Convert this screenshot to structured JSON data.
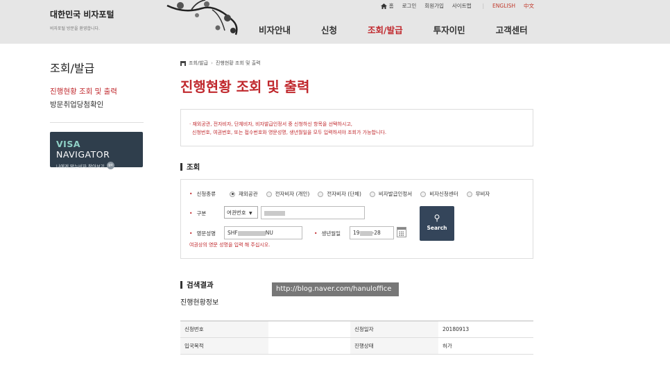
{
  "header": {
    "brand_title": "대한민국 비자포털",
    "brand_subtitle": "비자포털 방문을 환영합니다.",
    "utility": {
      "home": "홈",
      "login": "로그인",
      "join": "회원가입",
      "sitemap": "사이트맵",
      "english": "ENGLISH",
      "chinese": "中文"
    },
    "nav": [
      "비자안내",
      "신청",
      "조회/발급",
      "투자이민",
      "고객센터"
    ],
    "accent_color": "#c0282d"
  },
  "sidebar": {
    "title": "조회/발급",
    "items": [
      "진행현황 조회 및 출력",
      "방문취업당첨확인"
    ],
    "banner": {
      "title_bold": "VISA",
      "title_rest": " NAVIGATOR",
      "subtitle": "나에게 맞는비자 찾아보기",
      "go": "go"
    }
  },
  "main": {
    "breadcrumb": [
      "조회/발급",
      "진행현황 조회 및 출력"
    ],
    "title": "진행현황 조회 및 출력",
    "notice_line1": "· 재외공관, 전자비자, 단체비자, 비자발급인정서 중 신청하신 항목을 선택하시고,",
    "notice_line2": "신청번호, 여권번호, 또는 접수번호와 영문성명, 생년월일을 모두 입력하셔야 조회가 가능합니다.",
    "search_section": "조회",
    "form": {
      "type_label": "신청종류",
      "type_options": [
        "재외공관",
        "전자비자 (개인)",
        "전자비자 (단체)",
        "비자발급인정서",
        "비자신청센터",
        "무비자"
      ],
      "type_selected": "재외공관",
      "category_label": "구분",
      "category_select": "여권번호",
      "category_value": "",
      "name_label": "영문성명",
      "name_prefix": "SHF",
      "name_suffix": "NU",
      "birth_label": "생년월일",
      "birth_prefix": "19",
      "birth_suffix": "-28",
      "hint": "여권상의 영문 성명을 입력 해 주십시오.",
      "search_button": "Search"
    },
    "watermark": "http://blog.naver.com/hanuloffice",
    "result_section": "검색결과",
    "result_subtitle": "진행현황정보",
    "result_table": [
      {
        "label1": "신청번호",
        "value1": "",
        "label2": "신청일자",
        "value2": "20180913"
      },
      {
        "label1": "입국목적",
        "value1": "",
        "label2": "진행상태",
        "value2": "허가"
      }
    ]
  }
}
